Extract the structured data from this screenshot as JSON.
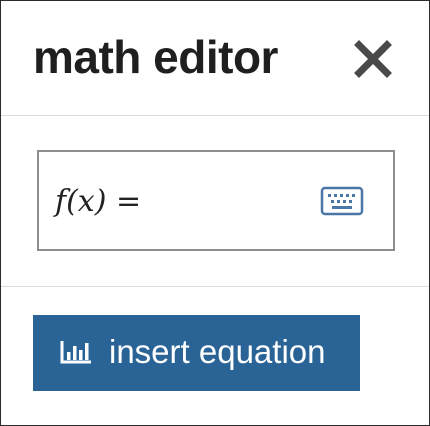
{
  "dialog": {
    "title": "math editor",
    "close_icon": "close-icon"
  },
  "editor": {
    "expression": "f(x) =",
    "keyboard_icon": "keyboard-icon"
  },
  "footer": {
    "insert_label": "insert equation",
    "insert_icon": "chart-bar-icon"
  },
  "colors": {
    "button_bg": "#2a6496",
    "keyboard_icon": "#4a76a8",
    "title_text": "#1f1f1f",
    "field_border": "#8d8d8d"
  }
}
